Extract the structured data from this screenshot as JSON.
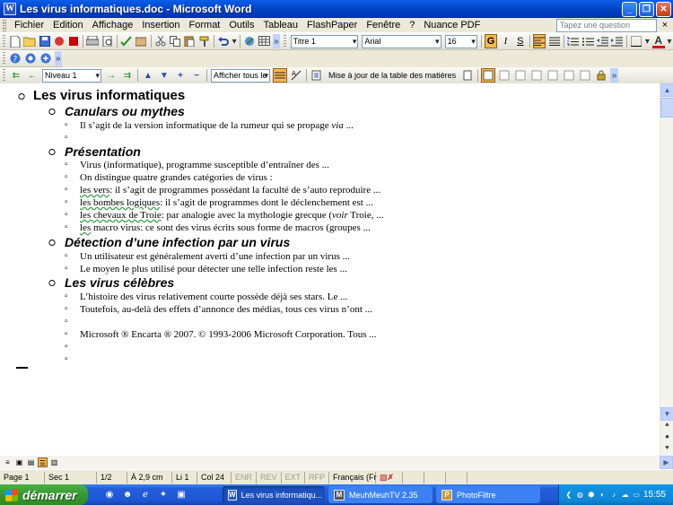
{
  "window": {
    "title": "Les virus informatiques.doc - Microsoft Word",
    "icon_letter": "W",
    "min_label": "_",
    "max_label": "❐",
    "close_label": "✕"
  },
  "menubar": {
    "items": [
      "Fichier",
      "Edition",
      "Affichage",
      "Insertion",
      "Format",
      "Outils",
      "Tableau",
      "FlashPaper",
      "Fenêtre",
      "?",
      "Nuance PDF"
    ],
    "ask_placeholder": "Tapez une question",
    "close_doc": "×"
  },
  "formatting": {
    "style": "Titre 1",
    "font": "Arial",
    "size": "16",
    "bold_label": "G",
    "italic_label": "I",
    "underline_label": "S"
  },
  "outline_toolbar": {
    "level": "Niveau 1",
    "show_levels": "Afficher tous le",
    "update_toc": "Mise à jour de la table des matières"
  },
  "document": {
    "title": "Les virus informatiques",
    "sections": [
      {
        "heading": "Canulars ou mythes",
        "items": [
          {
            "pre": "Il s’agit de la version informatique de la rumeur qui se propage ",
            "em": "via",
            "post": " ..."
          },
          {
            "pre": ""
          }
        ]
      },
      {
        "heading": "Présentation",
        "items": [
          {
            "pre": "Virus (informatique), programme susceptible d’entraîner des ..."
          },
          {
            "pre": "On distingue quatre grandes catégories de virus :"
          },
          {
            "ul": "les vers",
            "post": ": il s’agit de programmes possédant la faculté de s’auto reproduire ..."
          },
          {
            "ul": "les bombes logiques",
            "post": ": il s’agit de programmes dont le déclenchement est ..."
          },
          {
            "ul": "les chevaux de Troie",
            "post": ": par analogie avec la mythologie grecque (",
            "em": "voir",
            "post2": " Troie, ..."
          },
          {
            "ul": "les",
            "post": " macro virus: ce sont des virus écrits sous forme de macros (groupes ..."
          }
        ]
      },
      {
        "heading": "Détection d’une infection par un virus",
        "items": [
          {
            "pre": "Un utilisateur est généralement averti d’une infection par un virus ..."
          },
          {
            "pre": "Le moyen le plus utilisé pour détecter une telle infection reste les ..."
          }
        ]
      },
      {
        "heading": "Les virus célèbres",
        "items": [
          {
            "pre": "L’histoire des virus relativement courte possède déjà ses stars. Le ..."
          },
          {
            "pre": "Toutefois, au-delà des effets d’annonce des médias, tous ces virus n’ont ..."
          },
          {
            "pre": ""
          },
          {
            "pre": "Microsoft ® Encarta ® 2007. © 1993-2006 Microsoft Corporation. Tous ..."
          },
          {
            "pre": ""
          },
          {
            "pre": ""
          }
        ]
      }
    ]
  },
  "statusbar": {
    "page": "Page  1",
    "section": "Sec  1",
    "pages": "1/2",
    "at": "À  2,9 cm",
    "line": "Li  1",
    "col": "Col  24",
    "enr": "ENR",
    "rev": "REV",
    "ext": "EXT",
    "rfp": "RFP",
    "lang": "Français (Fr"
  },
  "taskbar": {
    "start": "démarrer",
    "tasks": [
      {
        "label": "Les virus informatiqu...",
        "icon": "W",
        "active": true
      },
      {
        "label": "MeuhMeuhTV 2.35",
        "icon": "M",
        "active": false
      },
      {
        "label": "PhotoFiltre",
        "icon": "P",
        "active": false
      }
    ],
    "clock": "15:55"
  },
  "colors": {
    "titlebar": "#0447c9",
    "start": "#37982f",
    "tray": "#0f86d6",
    "highlight": "#ffb84d"
  }
}
